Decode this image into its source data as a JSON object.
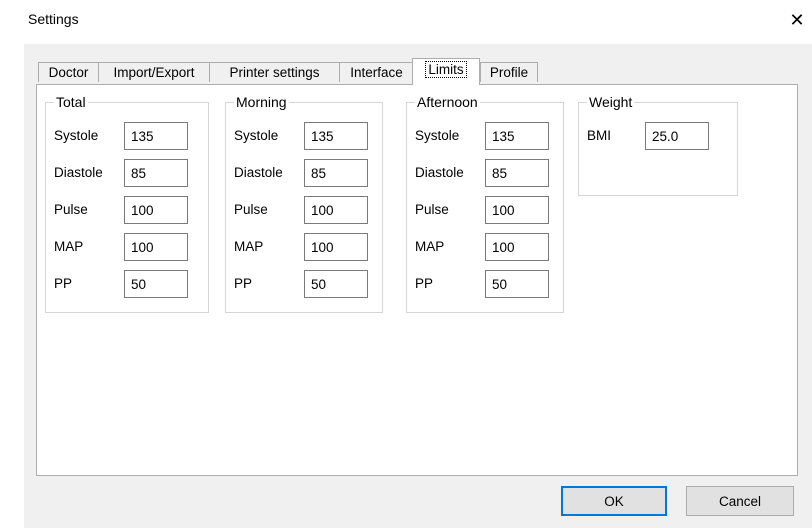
{
  "window": {
    "title": "Settings",
    "close_glyph": "✕"
  },
  "tabs": [
    {
      "label": "Doctor",
      "active": false
    },
    {
      "label": "Import/Export",
      "active": false
    },
    {
      "label": "Printer settings",
      "active": false
    },
    {
      "label": "Interface",
      "active": false
    },
    {
      "label": "Limits",
      "active": true
    },
    {
      "label": "Profile",
      "active": false
    }
  ],
  "groups": {
    "total": {
      "title": "Total",
      "systole": {
        "label": "Systole",
        "value": "135"
      },
      "diastole": {
        "label": "Diastole",
        "value": "85"
      },
      "pulse": {
        "label": "Pulse",
        "value": "100"
      },
      "map": {
        "label": "MAP",
        "value": "100"
      },
      "pp": {
        "label": "PP",
        "value": "50"
      }
    },
    "morning": {
      "title": "Morning",
      "systole": {
        "label": "Systole",
        "value": "135"
      },
      "diastole": {
        "label": "Diastole",
        "value": "85"
      },
      "pulse": {
        "label": "Pulse",
        "value": "100"
      },
      "map": {
        "label": "MAP",
        "value": "100"
      },
      "pp": {
        "label": "PP",
        "value": "50"
      }
    },
    "afternoon": {
      "title": "Afternoon",
      "systole": {
        "label": "Systole",
        "value": "135"
      },
      "diastole": {
        "label": "Diastole",
        "value": "85"
      },
      "pulse": {
        "label": "Pulse",
        "value": "100"
      },
      "map": {
        "label": "MAP",
        "value": "100"
      },
      "pp": {
        "label": "PP",
        "value": "50"
      }
    },
    "weight": {
      "title": "Weight",
      "bmi": {
        "label": "BMI",
        "value": "25.0"
      }
    }
  },
  "buttons": {
    "ok": "OK",
    "cancel": "Cancel"
  },
  "colors": {
    "accent": "#0078d7",
    "panel_bg": "#f0f0f0",
    "content_bg": "#ffffff"
  }
}
